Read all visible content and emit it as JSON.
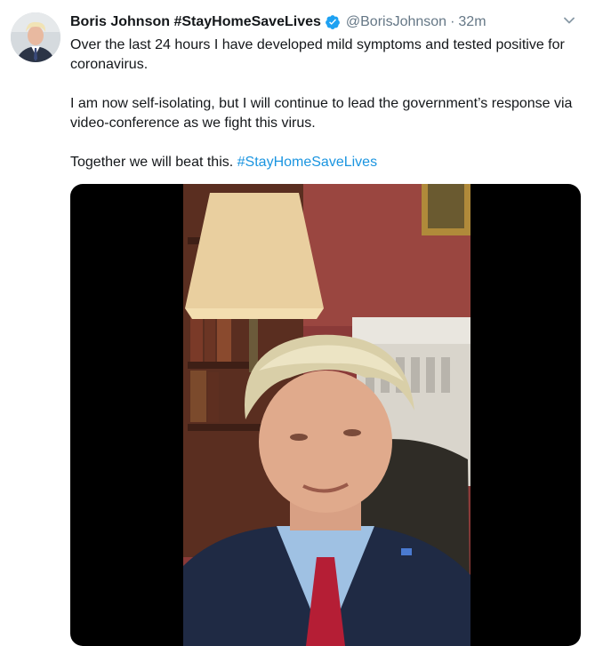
{
  "tweet": {
    "display_name": "Boris Johnson #StayHomeSaveLives",
    "handle": "@BorisJohnson",
    "separator": "·",
    "time": "32m",
    "paragraph1": "Over the last 24 hours I have developed mild symptoms and tested positive for coronavirus.",
    "paragraph2": "I am now self-isolating, but I will continue to lead the government’s response via video-conference as we fight this virus.",
    "paragraph3_text": "Together we will beat this. ",
    "paragraph3_hashtag": "#StayHomeSaveLives"
  },
  "icons": {
    "verified": "verified-badge-icon",
    "menu": "chevron-down-icon"
  },
  "colors": {
    "text": "#14171a",
    "secondary": "#657786",
    "link": "#1b95e0",
    "verified": "#1da1f2",
    "video_background": "#000000"
  }
}
